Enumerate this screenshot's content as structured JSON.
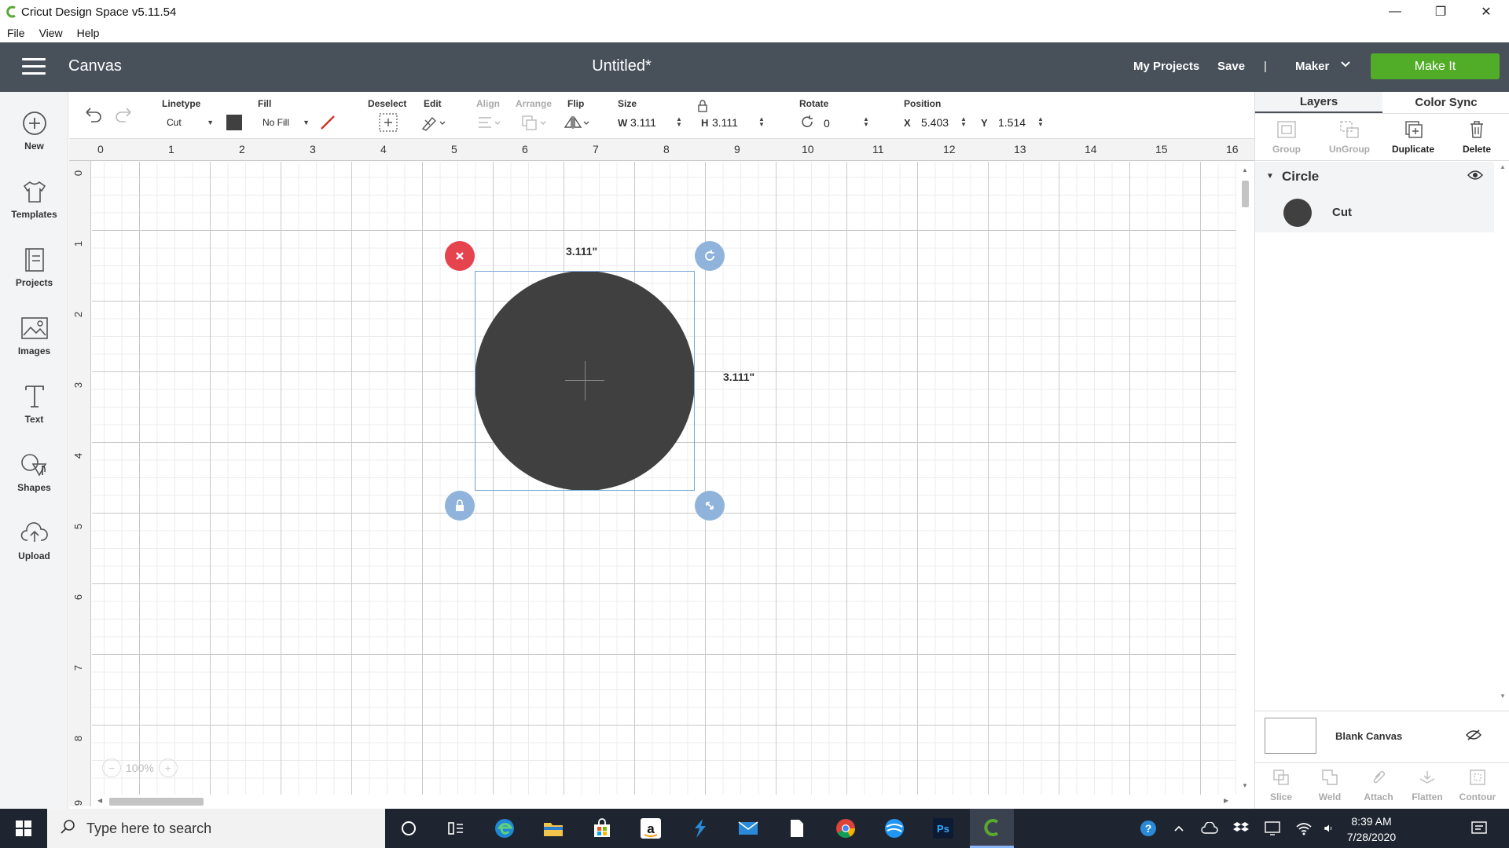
{
  "window": {
    "title": "Cricut Design Space  v5.11.54",
    "controls": [
      "minimize",
      "restore",
      "close"
    ]
  },
  "menu": [
    "File",
    "View",
    "Help"
  ],
  "header": {
    "section": "Canvas",
    "document_title": "Untitled*",
    "my_projects": "My Projects",
    "save": "Save",
    "separator": "|",
    "machine": "Maker",
    "make_it": "Make It"
  },
  "sidebar": [
    {
      "label": "New",
      "icon": "plus-circle-icon"
    },
    {
      "label": "Templates",
      "icon": "shirt-icon"
    },
    {
      "label": "Projects",
      "icon": "projects-icon"
    },
    {
      "label": "Images",
      "icon": "image-icon"
    },
    {
      "label": "Text",
      "icon": "text-icon"
    },
    {
      "label": "Shapes",
      "icon": "shapes-icon"
    },
    {
      "label": "Upload",
      "icon": "upload-cloud-icon"
    }
  ],
  "toolbar": {
    "linetype_label": "Linetype",
    "linetype_value": "Cut",
    "fill_label": "Fill",
    "fill_value": "No Fill",
    "deselect_label": "Deselect",
    "edit_label": "Edit",
    "align_label": "Align",
    "arrange_label": "Arrange",
    "flip_label": "Flip",
    "size_label": "Size",
    "w_label": "W",
    "w_value": "3.111",
    "h_label": "H",
    "h_value": "3.111",
    "rotate_label": "Rotate",
    "rotate_value": "0",
    "position_label": "Position",
    "x_label": "X",
    "x_value": "5.403",
    "y_label": "Y",
    "y_value": "1.514",
    "colors": {
      "linetype_swatch": "#404040",
      "fill_slash": "#d0342c"
    }
  },
  "ruler": {
    "horizontal": [
      "0",
      "1",
      "2",
      "3",
      "4",
      "5",
      "6",
      "7",
      "8",
      "9",
      "10",
      "11",
      "12",
      "13",
      "14",
      "15",
      "16"
    ],
    "vertical": [
      "0",
      "1",
      "2",
      "3",
      "4",
      "5",
      "6",
      "7",
      "8",
      "9"
    ]
  },
  "canvas": {
    "width_label": "3.111\"",
    "height_label": "3.111\"",
    "zoom": "100%",
    "shape_color": "#404040"
  },
  "right_panel": {
    "tabs": [
      "Layers",
      "Color Sync"
    ],
    "actions": [
      {
        "label": "Group",
        "enabled": false
      },
      {
        "label": "UnGroup",
        "enabled": false
      },
      {
        "label": "Duplicate",
        "enabled": true
      },
      {
        "label": "Delete",
        "enabled": true
      }
    ],
    "layer_group": "Circle",
    "layer_item": "Cut",
    "blank_canvas": "Blank Canvas",
    "bottom_actions": [
      "Slice",
      "Weld",
      "Attach",
      "Flatten",
      "Contour"
    ]
  },
  "taskbar": {
    "search_placeholder": "Type here to search",
    "time": "8:39 AM",
    "date": "7/28/2020"
  }
}
